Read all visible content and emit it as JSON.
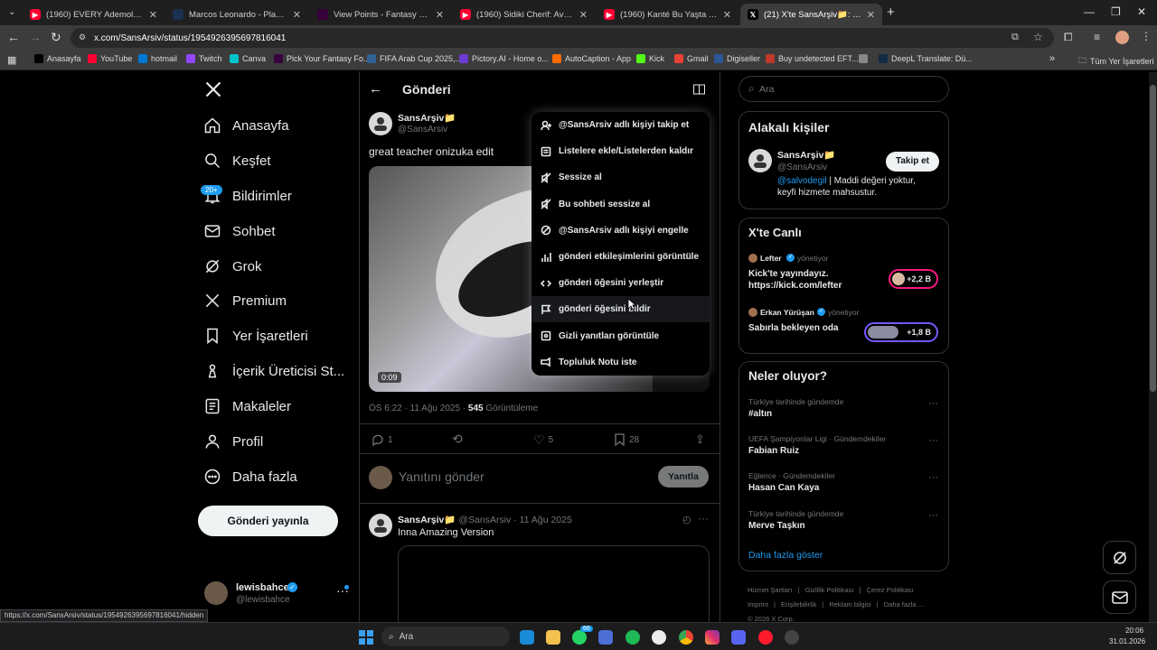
{
  "browser": {
    "tabs": [
      {
        "title": "(1960) EVERY Ademola Lookma",
        "icon": "youtube-icon",
        "color": "#ff0033"
      },
      {
        "title": "Marcos Leonardo - Player profil",
        "icon": "transfermarkt-icon",
        "color": "#1a3151"
      },
      {
        "title": "View Points - Fantasy Premier L",
        "icon": "fpl-icon",
        "color": "#38003c"
      },
      {
        "title": "(1960) Sidiki Cherif: Avcı | Transf",
        "icon": "youtube-icon",
        "color": "#ff0033"
      },
      {
        "title": "(1960) Kanté Bu Yaşta Hâlâ Elit",
        "icon": "youtube-icon",
        "color": "#ff0033"
      },
      {
        "title": "(21) X'te SansArşiv📁: \"great te",
        "icon": "x-icon",
        "color": "#000000"
      }
    ],
    "url": "x.com/SansArsiv/status/1954926395697816041",
    "bookmarks": [
      {
        "label": "Anasayfa",
        "color": "#000000"
      },
      {
        "label": "YouTube",
        "color": "#ff0033"
      },
      {
        "label": "hotmail",
        "color": "#0078d4"
      },
      {
        "label": "Twitch",
        "color": "#9146ff"
      },
      {
        "label": "Canva",
        "color": "#00c4cc"
      },
      {
        "label": "Pick Your Fantasy Fo...",
        "color": "#38003c"
      },
      {
        "label": "FIFA Arab Cup 2025,...",
        "color": "#326295"
      },
      {
        "label": "Pictory.AI - Home o...",
        "color": "#6c3bd1"
      },
      {
        "label": "AutoCaption - App",
        "color": "#ff6b00"
      },
      {
        "label": "Kick",
        "color": "#53fc18"
      },
      {
        "label": "Gmail",
        "color": "#ea4335"
      },
      {
        "label": "Digiseller",
        "color": "#2b5797"
      },
      {
        "label": "Buy undetected EFT...",
        "color": "#c0392b"
      },
      {
        "label": "",
        "color": "#888888"
      },
      {
        "label": "DeepL Translate: Dü...",
        "color": "#0f2b46"
      }
    ],
    "all_bookmarks": "Tüm Yer İşaretleri",
    "status_url": "https://x.com/SansArsiv/status/1954926395697816041/hidden"
  },
  "nav": {
    "items": [
      "Anasayfa",
      "Keşfet",
      "Bildirimler",
      "Sohbet",
      "Grok",
      "Premium",
      "Yer İşaretleri",
      "İçerik Üreticisi St...",
      "Makaleler",
      "Profil",
      "Daha fazla"
    ],
    "notif_badge": "20+",
    "post_button": "Gönderi yayınla",
    "user_name": "lewisbahce",
    "user_handle": "@lewisbahce"
  },
  "main": {
    "header": "Gönderi",
    "author_name": "SansArşiv📁",
    "author_handle": "@SansArsiv",
    "text": "great teacher onizuka edit",
    "video_time": "0:09",
    "meta_time": "ÖS 6:22 · 11 Ağu 2025 · ",
    "views_count": "545",
    "views_label": " Görüntüleme",
    "replies": "1",
    "likes": "5",
    "bookmarks": "28",
    "reply_placeholder": "Yanıtını gönder",
    "reply_button": "Yanıtla",
    "reply_post": {
      "name": "SansArşiv📁",
      "handle_date": "@SansArsiv · 11 Ağu 2025",
      "text": "Inna Amazing Version"
    }
  },
  "menu": {
    "items": [
      {
        "label": "@SansArsiv adlı kişiyi takip et",
        "icon": "follow-icon"
      },
      {
        "label": "Listelere ekle/Listelerden kaldır",
        "icon": "list-icon"
      },
      {
        "label": "Sessize al",
        "icon": "mute-icon"
      },
      {
        "label": "Bu sohbeti sessize al",
        "icon": "mute-conversation-icon"
      },
      {
        "label": "@SansArsiv adlı kişiyi engelle",
        "icon": "block-icon"
      },
      {
        "label": "gönderi etkileşimlerini görüntüle",
        "icon": "analytics-icon"
      },
      {
        "label": "gönderi öğesini yerleştir",
        "icon": "embed-icon"
      },
      {
        "label": "gönderi öğesini bildir",
        "icon": "flag-icon"
      },
      {
        "label": "Gizli yanıtları görüntüle",
        "icon": "hidden-replies-icon"
      },
      {
        "label": "Topluluk Notu iste",
        "icon": "community-note-icon"
      }
    ]
  },
  "right": {
    "search_placeholder": "Ara",
    "related_title": "Alakalı kişiler",
    "related_name": "SansArşiv📁",
    "related_handle": "@SansArsiv",
    "related_mention": "@salvodegil",
    "related_bio": " | Maddi değeri yoktur, keyfi hizmete mahsustur.",
    "follow_button": "Takip et",
    "live_title": "X'te Canlı",
    "live": [
      {
        "host": "Lefter",
        "role": "yönetiyor",
        "title": "Kick'te yayındayız. https://kick.com/lefter",
        "count": "+2,2 B"
      },
      {
        "host": "Erkan Yürüşan",
        "role": "yönetiyor",
        "title": "Sabırla bekleyen oda",
        "count": "+1,8 B"
      }
    ],
    "trends_title": "Neler oluyor?",
    "trends": [
      {
        "category": "Türkiye tarihinde gündemde",
        "name": "#altın"
      },
      {
        "category": "UEFA Şampiyonlar Ligi · Gündemdekiler",
        "name": "Fabian Ruiz"
      },
      {
        "category": "Eğlence · Gündemdekiler",
        "name": "Hasan Can Kaya"
      },
      {
        "category": "Türkiye tarihinde gündemde",
        "name": "Merve Taşkın"
      }
    ],
    "show_more": "Daha fazla göster",
    "footer": [
      "Hizmet Şartları",
      "Gizlilik Politikası",
      "Çerez Politikası",
      "Imprint",
      "Erişilebilirlik",
      "Reklam bilgisi",
      "Daha fazla ...",
      "© 2026 X Corp."
    ]
  },
  "taskbar": {
    "search": "Ara",
    "time": "20:06",
    "date": "31.01.2026",
    "badge": "66"
  }
}
